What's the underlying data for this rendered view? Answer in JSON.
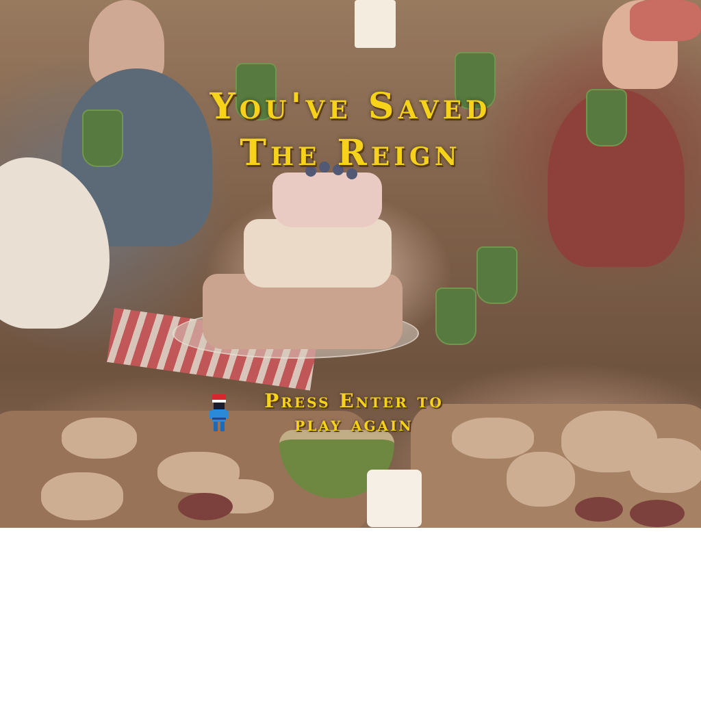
{
  "screen": {
    "title_line_1": "You've Saved",
    "title_line_2": "The Reign",
    "prompt_line_1": "Press Enter to",
    "prompt_line_2": "play again"
  },
  "player": {
    "icon": "pixel-hero-icon"
  },
  "colors": {
    "title_text": "#f6d21a",
    "text_shadow": "#5a3a10",
    "page_background": "#ffffff"
  }
}
